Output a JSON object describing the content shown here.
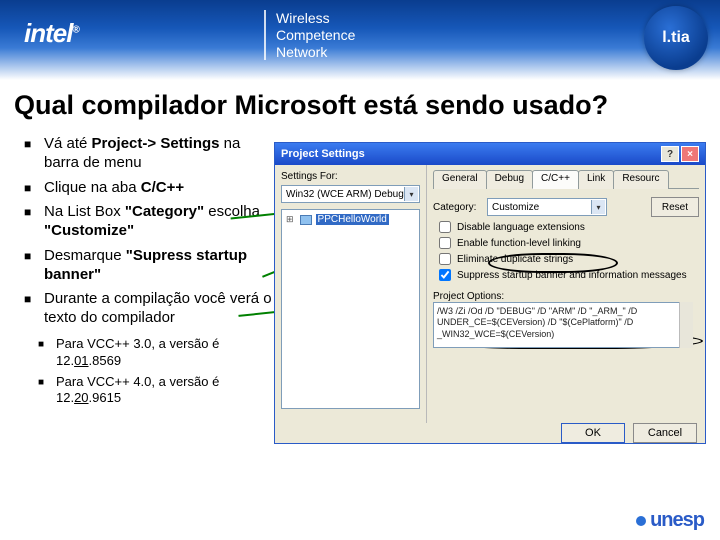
{
  "header": {
    "brand": "intel",
    "brand_reg": "®",
    "program_l1": "Wireless",
    "program_l2": "Competence",
    "program_l3": "Network",
    "tia": "l.tia"
  },
  "title": "Qual compilador Microsoft está sendo usado?",
  "bullets": {
    "b1_pre": "Vá até ",
    "b1_bold": "Project-> Settings",
    "b1_post": " na barra de menu",
    "b2_pre": "Clique na aba ",
    "b2_bold": "C/C++",
    "b3_pre": "Na List Box ",
    "b3_bold1": "\"Category\"",
    "b3_mid": " escolha ",
    "b3_bold2": "\"Customize\"",
    "b4_pre": "Desmarque ",
    "b4_bold": "\"Supress startup banner\"",
    "b5": "Durante a compilação você verá o texto do compilador",
    "s1_pre": "Para VCC++ 3.0, a versão é 12.",
    "s1_u": "01",
    "s1_post": ".8569",
    "s2_pre": "Para VCC++ 4.0, a versão é 12.",
    "s2_u": "20",
    "s2_post": ".9615"
  },
  "dialog": {
    "title": "Project Settings",
    "help": "?",
    "close": "×",
    "settings_for_label": "Settings For:",
    "settings_for_value": "Win32 (WCE ARM) Debug",
    "tree_item": "PPCHelloWorld",
    "tabs": {
      "general": "General",
      "debug": "Debug",
      "cpp": "C/C++",
      "link": "Link",
      "resource": "Resourc"
    },
    "category_label": "Category:",
    "category_value": "Customize",
    "reset": "Reset",
    "chk1": "Disable language extensions",
    "chk2": "Enable function-level linking",
    "chk3": "Eliminate duplicate strings",
    "chk4": "Suppress startup banner and information messages",
    "opts_label": "Project Options:",
    "opts_text": "/W3 /Zi /Od /D \"DEBUG\" /D \"ARM\" /D \"_ARM_\" /D UNDER_CE=$(CEVersion) /D \"$(CePlatform)\" /D _WIN32_WCE=$(CEVersion)",
    "ok": "OK",
    "cancel": "Cancel"
  },
  "footer": {
    "text": "unesp"
  }
}
